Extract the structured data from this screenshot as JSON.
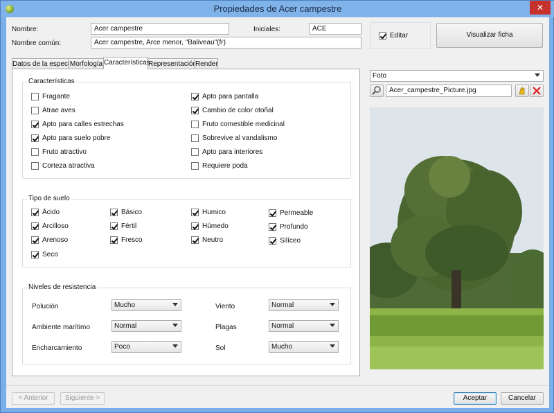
{
  "window": {
    "title": "Propiedades de Acer campestre",
    "close_label": "✕",
    "app_icon": "leaf-app-icon"
  },
  "header": {
    "nombre_label": "Nombre:",
    "nombre_value": "Acer campestre",
    "iniciales_label": "Iniciales:",
    "iniciales_value": "ACE",
    "nombre_comun_label": "Nombre común:",
    "nombre_comun_value": "Acer campestre, Arce menor, \"Baliveau\"(fr)",
    "editar_label": "Editar",
    "editar_checked": true,
    "visualizar_label": "Visualizar ficha"
  },
  "tabs": [
    {
      "label": "Datos de la especie",
      "active": false
    },
    {
      "label": "Morfología",
      "active": false
    },
    {
      "label": "Características",
      "active": true
    },
    {
      "label": "Representación",
      "active": false
    },
    {
      "label": "Render",
      "active": false
    }
  ],
  "caracteristicas": {
    "title": "Características",
    "items": [
      {
        "label": "Fragante",
        "checked": false
      },
      {
        "label": "Atrae aves",
        "checked": false
      },
      {
        "label": "Apto para calles estrechas",
        "checked": true
      },
      {
        "label": "Apto para suelo pobre",
        "checked": true
      },
      {
        "label": "Fruto atractivo",
        "checked": false
      },
      {
        "label": "Corteza atractiva",
        "checked": false
      },
      {
        "label": "Apto para pantalla",
        "checked": true
      },
      {
        "label": "Cambio de color otoñal",
        "checked": true
      },
      {
        "label": "Fruto comestible medicinal",
        "checked": false
      },
      {
        "label": "Sobrevive al vandalismo",
        "checked": false
      },
      {
        "label": "Apto para interiores",
        "checked": false
      },
      {
        "label": "Requiere poda",
        "checked": false
      }
    ]
  },
  "suelo": {
    "title": "Tipo de suelo",
    "items": [
      {
        "label": "Ácido",
        "checked": true
      },
      {
        "label": "Arcilloso",
        "checked": true
      },
      {
        "label": "Arenoso",
        "checked": true
      },
      {
        "label": "Seco",
        "checked": true
      },
      {
        "label": "Básico",
        "checked": true
      },
      {
        "label": "Fértil",
        "checked": true
      },
      {
        "label": "Fresco",
        "checked": true
      },
      {
        "label": "Humico",
        "checked": true
      },
      {
        "label": "Húmedo",
        "checked": true
      },
      {
        "label": "Neutro",
        "checked": true
      },
      {
        "label": "Permeable",
        "checked": true
      },
      {
        "label": "Profundo",
        "checked": true
      },
      {
        "label": "Silíceo",
        "checked": true
      }
    ]
  },
  "resistencia": {
    "title": "Niveles de resistencia",
    "rows": [
      {
        "label": "Polución",
        "value": "Mucho"
      },
      {
        "label": "Ambiente marítimo",
        "value": "Normal"
      },
      {
        "label": "Encharcamiento",
        "value": "Poco"
      },
      {
        "label": "Viento",
        "value": "Normal"
      },
      {
        "label": "Plagas",
        "value": "Normal"
      },
      {
        "label": "Sol",
        "value": "Mucho"
      }
    ]
  },
  "image_panel": {
    "type_value": "Foto",
    "filename": "Acer_campestre_Picture.jpg",
    "search_icon": "search-icon",
    "folder_icon": "folder-icon",
    "delete_icon": "delete-icon"
  },
  "footer": {
    "anterior_label": "< Anterior",
    "siguiente_label": "Siguiente >",
    "aceptar_label": "Aceptar",
    "cancelar_label": "Cancelar"
  },
  "colors": {
    "titlebar": "#7fb3ea",
    "close": "#c7312b",
    "client": "#f0f0f0"
  }
}
